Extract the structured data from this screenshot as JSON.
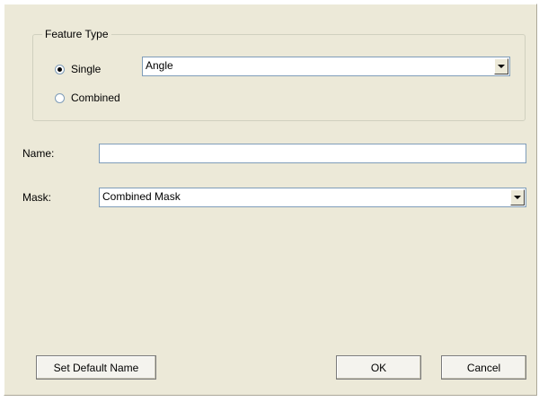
{
  "feature_type": {
    "group_label": "Feature Type",
    "single_label": "Single",
    "combined_label": "Combined",
    "selected": "Single",
    "single_value": "Angle"
  },
  "name": {
    "label": "Name:",
    "value": ""
  },
  "mask": {
    "label": "Mask:",
    "value": "Combined Mask"
  },
  "buttons": {
    "set_default_name": "Set Default Name",
    "ok": "OK",
    "cancel": "Cancel"
  }
}
